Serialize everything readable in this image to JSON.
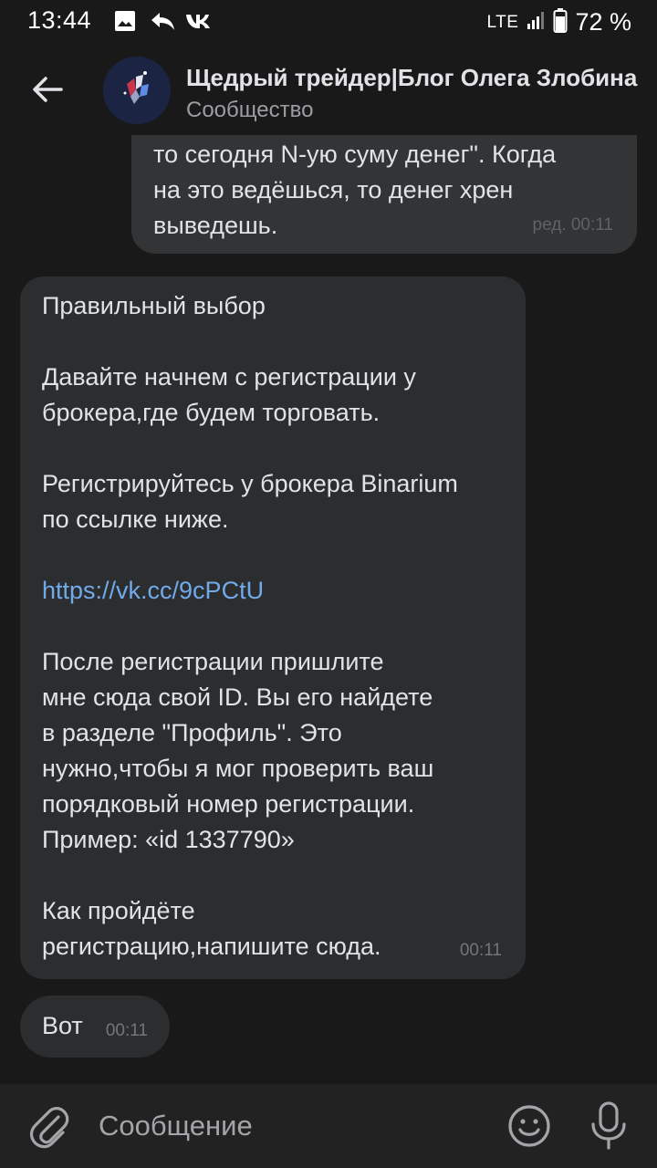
{
  "status_bar": {
    "time": "13:44",
    "icons": [
      "image-icon",
      "reply-icon",
      "vk-icon"
    ],
    "network": "LTE",
    "battery": "72 %"
  },
  "header": {
    "title": "Щедрый трейдер|Блог Олега Злобина",
    "subtitle": "Сообщество",
    "back_icon": "arrow-left-icon"
  },
  "messages": [
    {
      "direction": "outgoing",
      "text": "то сегодня N-ую суму денег\". Когда\nна это ведёшься, то денег хрен\nвыведешь.",
      "meta": "ред. 00:11"
    },
    {
      "direction": "incoming",
      "text_before_link": "Правильный выбор\n\nДавайте начнем с регистрации у\nброкера,где будем торговать.\n\nРегистрируйтесь у брокера Binarium\nпо ссылке ниже.\n\n",
      "link": "https://vk.cc/9cPCtU",
      "text_after_link": "\n\nПосле регистрации пришлите\nмне сюда свой ID. Вы его найдете\nв разделе \"Профиль\". Это\nнужно,чтобы я мог проверить ваш\nпорядковый номер регистрации.\nПример: «id 1337790»\n\nКак пройдёте\nрегистрацию,напишите сюда.",
      "meta": "00:11"
    },
    {
      "direction": "incoming",
      "text": "Вот",
      "meta": "00:11"
    }
  ],
  "composer": {
    "placeholder": "Сообщение",
    "icons": [
      "paperclip-icon",
      "emoji-icon",
      "microphone-icon"
    ]
  },
  "colors": {
    "background": "#19191a",
    "bubble_incoming": "#2c2d2f",
    "bubble_outgoing": "#333436",
    "link": "#71aaeb",
    "text": "#e1e3e6",
    "secondary_text": "#9c9ea3"
  }
}
